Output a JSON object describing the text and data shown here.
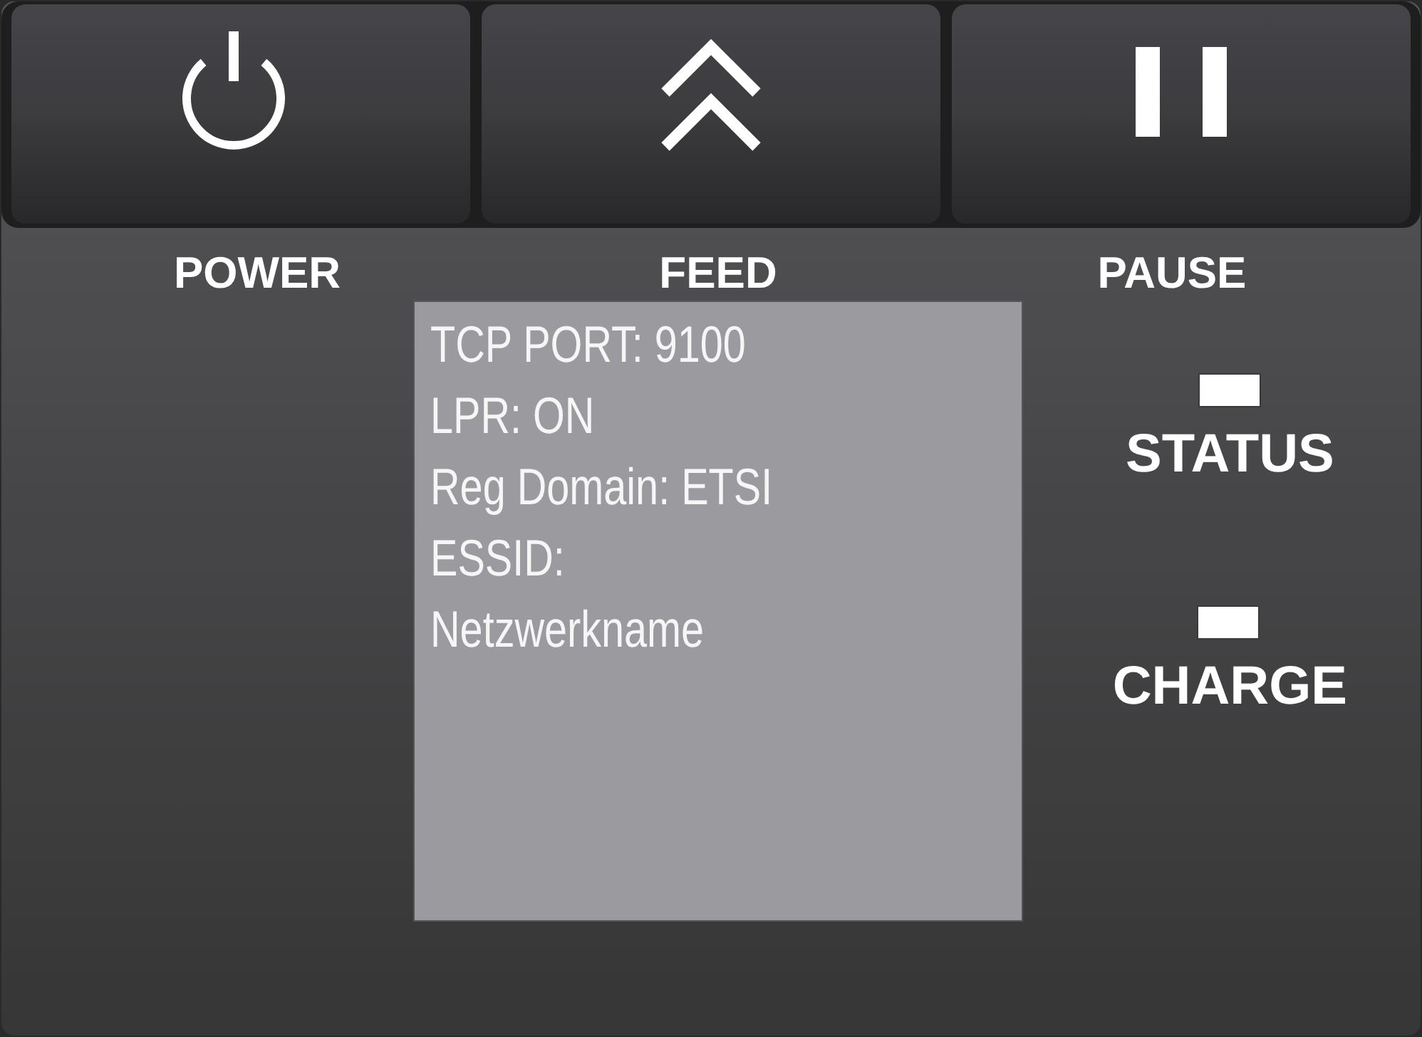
{
  "buttons": [
    {
      "kind": "power",
      "label": "POWER"
    },
    {
      "kind": "feed",
      "label": "FEED"
    },
    {
      "kind": "pause",
      "label": "PAUSE"
    }
  ],
  "display": {
    "lines": [
      "TCP PORT: 9100",
      "LPR: ON",
      "Reg Domain: ETSI",
      "ESSID:",
      "Netzwerkname"
    ]
  },
  "indicators": [
    {
      "label": "STATUS"
    },
    {
      "label": "CHARGE"
    }
  ]
}
